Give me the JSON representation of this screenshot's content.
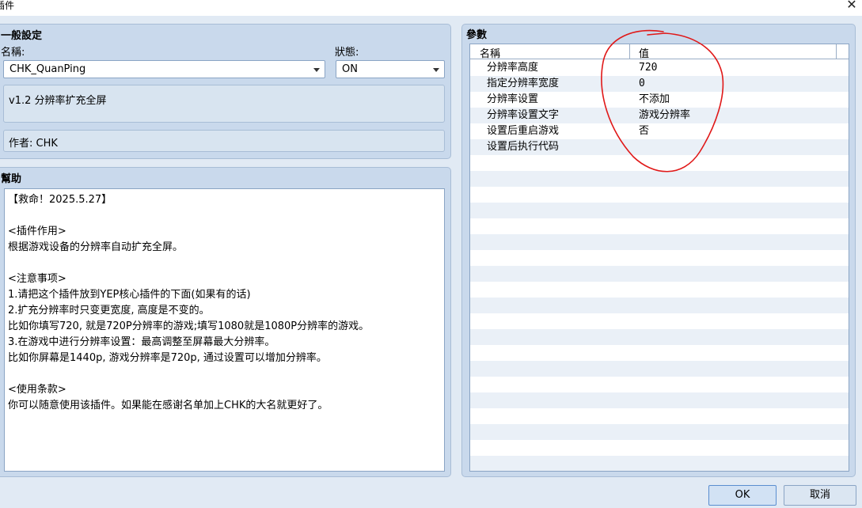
{
  "window": {
    "title": "插件",
    "close_glyph": "✕"
  },
  "general": {
    "title": "一般設定",
    "name_label": "名稱:",
    "name_value": "CHK_QuanPing",
    "status_label": "狀態:",
    "status_value": "ON",
    "description": "v1.2 分辨率扩充全屏",
    "author": "作者: CHK"
  },
  "help": {
    "title": "幫助",
    "text": "【救命！2025.5.27】\n\n<插件作用>\n根据游戏设备的分辨率自动扩充全屏。\n\n<注意事项>\n1.请把这个插件放到YEP核心插件的下面(如果有的话)\n2.扩充分辨率时只变更宽度, 高度是不变的。\n比如你填写720, 就是720P分辨率的游戏;填写1080就是1080P分辨率的游戏。\n3.在游戏中进行分辨率设置：最高调整至屏幕最大分辨率。\n比如你屏幕是1440p, 游戏分辨率是720p, 通过设置可以增加分辨率。\n\n<使用条款>\n你可以随意使用该插件。如果能在感谢名单加上CHK的大名就更好了。"
  },
  "params": {
    "title": "參數",
    "col_name": "名稱",
    "col_value": "值",
    "rows": [
      {
        "name": "分辨率高度",
        "value": "720"
      },
      {
        "name": "指定分辨率宽度",
        "value": "0"
      },
      {
        "name": "分辨率设置",
        "value": "不添加"
      },
      {
        "name": "分辨率设置文字",
        "value": "游戏分辨率"
      },
      {
        "name": "设置后重启游戏",
        "value": "否"
      },
      {
        "name": "设置后执行代码",
        "value": ""
      },
      {
        "name": "",
        "value": ""
      },
      {
        "name": "",
        "value": ""
      },
      {
        "name": "",
        "value": ""
      },
      {
        "name": "",
        "value": ""
      },
      {
        "name": "",
        "value": ""
      },
      {
        "name": "",
        "value": ""
      },
      {
        "name": "",
        "value": ""
      },
      {
        "name": "",
        "value": ""
      },
      {
        "name": "",
        "value": ""
      },
      {
        "name": "",
        "value": ""
      },
      {
        "name": "",
        "value": ""
      },
      {
        "name": "",
        "value": ""
      },
      {
        "name": "",
        "value": ""
      },
      {
        "name": "",
        "value": ""
      },
      {
        "name": "",
        "value": ""
      },
      {
        "name": "",
        "value": ""
      },
      {
        "name": "",
        "value": ""
      },
      {
        "name": "",
        "value": ""
      },
      {
        "name": "",
        "value": ""
      },
      {
        "name": "",
        "value": ""
      }
    ]
  },
  "buttons": {
    "ok": "OK",
    "cancel": "取消"
  },
  "colors": {
    "panel_bg": "#c9d9ec",
    "window_bg": "#e1eaf4",
    "annotation": "#e01818"
  }
}
